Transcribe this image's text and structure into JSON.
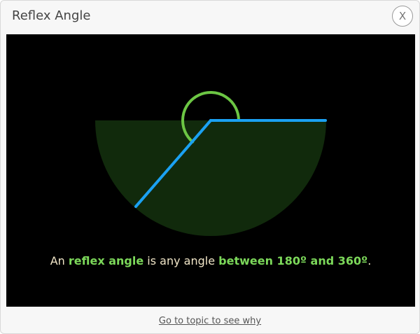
{
  "dialog": {
    "title": "Reflex Angle",
    "close_label": "X"
  },
  "caption": {
    "part1": "An ",
    "highlight1": "reflex angle",
    "part2": " is any angle ",
    "highlight2": "between 180º and 360º",
    "part3": "."
  },
  "footer": {
    "link_text": "Go to topic to see why"
  },
  "colors": {
    "stage_bg": "#000000",
    "sector_fill": "#112a0c",
    "arc_stroke": "#6cc644",
    "ray_stroke": "#1ba1f2",
    "caption_text": "#f1e6c8",
    "caption_highlight": "#7cd85a"
  }
}
